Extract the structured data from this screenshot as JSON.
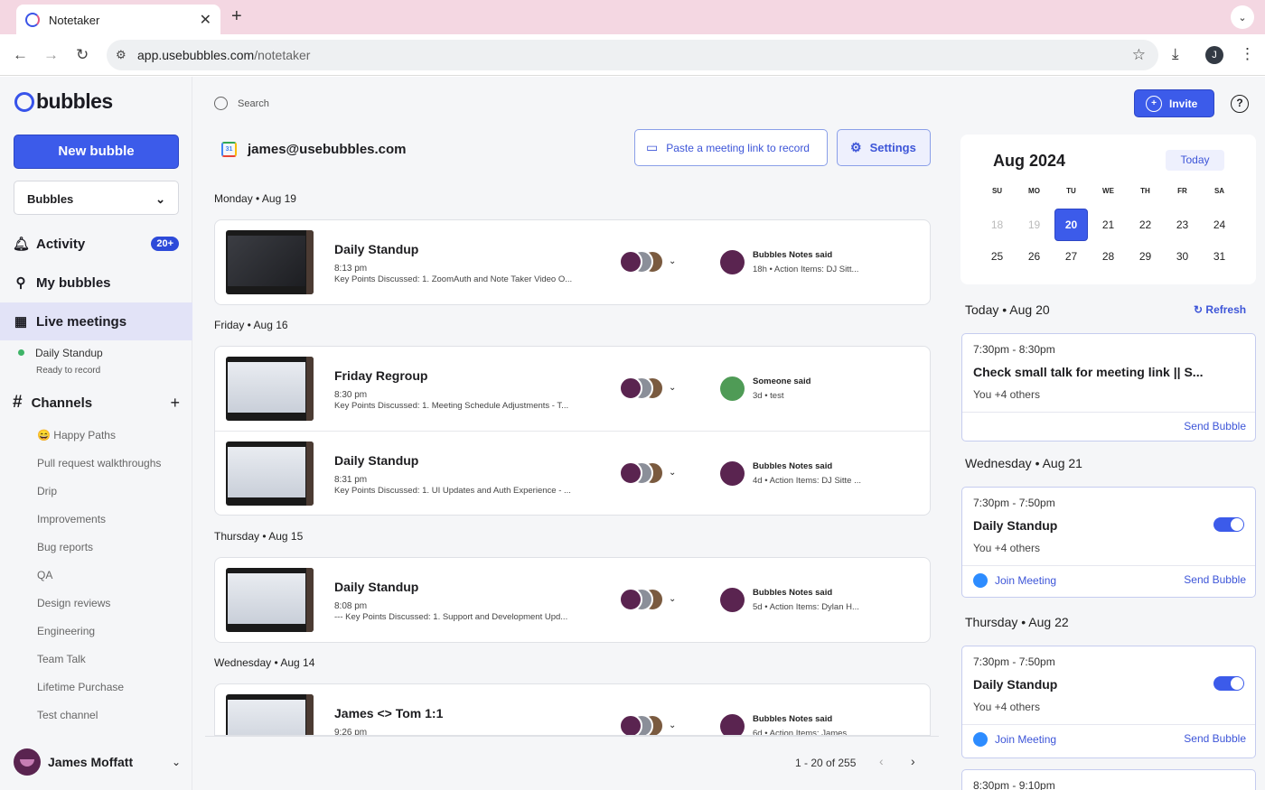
{
  "browser": {
    "tab_title": "Notetaker",
    "url_host": "app.usebubbles.com",
    "url_path": "/notetaker",
    "profile_initial": "J"
  },
  "sidebar": {
    "logo": "bubbles",
    "new_bubble": "New bubble",
    "workspace_select": "Bubbles",
    "nav": [
      {
        "label": "Activity",
        "badge": "20+",
        "icon": "bell-icon"
      },
      {
        "label": "My bubbles",
        "icon": "share-nodes-icon"
      },
      {
        "label": "Live meetings",
        "icon": "calendar-icon"
      }
    ],
    "live_meeting": {
      "name": "Daily Standup",
      "status": "Ready to record"
    },
    "channels_title": "Channels",
    "channels": [
      "😄 Happy Paths",
      "Pull request walkthroughs",
      "Drip",
      "Improvements",
      "Bug reports",
      "QA",
      "Design reviews",
      "Engineering",
      "Team Talk",
      "Lifetime Purchase",
      "Test channel"
    ],
    "user_name": "James Moffatt"
  },
  "main": {
    "search_placeholder": "Search",
    "account_email": "james@usebubbles.com",
    "paste_label": "Paste a meeting link to record",
    "settings_label": "Settings",
    "days": [
      {
        "label": "Monday • Aug 19",
        "meetings": [
          {
            "title": "Daily Standup",
            "time": "8:13 pm",
            "summary": "Key Points Discussed: 1. ZoomAuth and Note Taker Video O...",
            "commenter": "Bubbles Notes said",
            "comment": "18h • Action Items: DJ Sitt..."
          }
        ]
      },
      {
        "label": "Friday • Aug 16",
        "meetings": [
          {
            "title": "Friday Regroup",
            "time": "8:30 pm",
            "summary": "Key Points Discussed: 1. Meeting Schedule Adjustments - T...",
            "commenter": "Someone said",
            "comment": "3d • test"
          },
          {
            "title": "Daily Standup",
            "time": "8:31 pm",
            "summary": "Key Points Discussed: 1. UI Updates and Auth Experience - ...",
            "commenter": "Bubbles Notes said",
            "comment": "4d • Action Items: DJ Sitte ..."
          }
        ]
      },
      {
        "label": "Thursday • Aug 15",
        "meetings": [
          {
            "title": "Daily Standup",
            "time": "8:08 pm",
            "summary": "--- Key Points Discussed: 1. Support and Development Upd...",
            "commenter": "Bubbles Notes said",
            "comment": "5d • Action Items: Dylan H..."
          }
        ]
      },
      {
        "label": "Wednesday • Aug 14",
        "meetings": [
          {
            "title": "James <> Tom 1:1",
            "time": "9:26 pm",
            "summary": "",
            "commenter": "Bubbles Notes said",
            "comment": "6d • Action Items: James ..."
          }
        ]
      }
    ],
    "pagination": "1 - 20 of 255"
  },
  "right": {
    "invite_label": "Invite",
    "calendar": {
      "month": "Aug 2024",
      "today_label": "Today",
      "dows": [
        "SU",
        "MO",
        "TU",
        "WE",
        "TH",
        "FR",
        "SA"
      ],
      "week1": [
        "18",
        "19",
        "20",
        "21",
        "22",
        "23",
        "24"
      ],
      "week2": [
        "25",
        "26",
        "27",
        "28",
        "29",
        "30",
        "31"
      ],
      "selected": "20"
    },
    "today_heading": "Today • Aug 20",
    "refresh_label": "Refresh",
    "event1": {
      "time": "7:30pm - 8:30pm",
      "title": "Check small talk for meeting link || S...",
      "people": "You +4 others",
      "send": "Send Bubble"
    },
    "wed_heading": "Wednesday • Aug 21",
    "event2": {
      "time": "7:30pm - 7:50pm",
      "title": "Daily Standup",
      "people": "You +4 others",
      "join": "Join Meeting",
      "send": "Send Bubble"
    },
    "thu_heading": "Thursday • Aug 22",
    "event3": {
      "time": "7:30pm - 7:50pm",
      "title": "Daily Standup",
      "people": "You +4 others",
      "join": "Join Meeting",
      "send": "Send Bubble"
    },
    "event4": {
      "time": "8:30pm - 9:10pm"
    }
  }
}
